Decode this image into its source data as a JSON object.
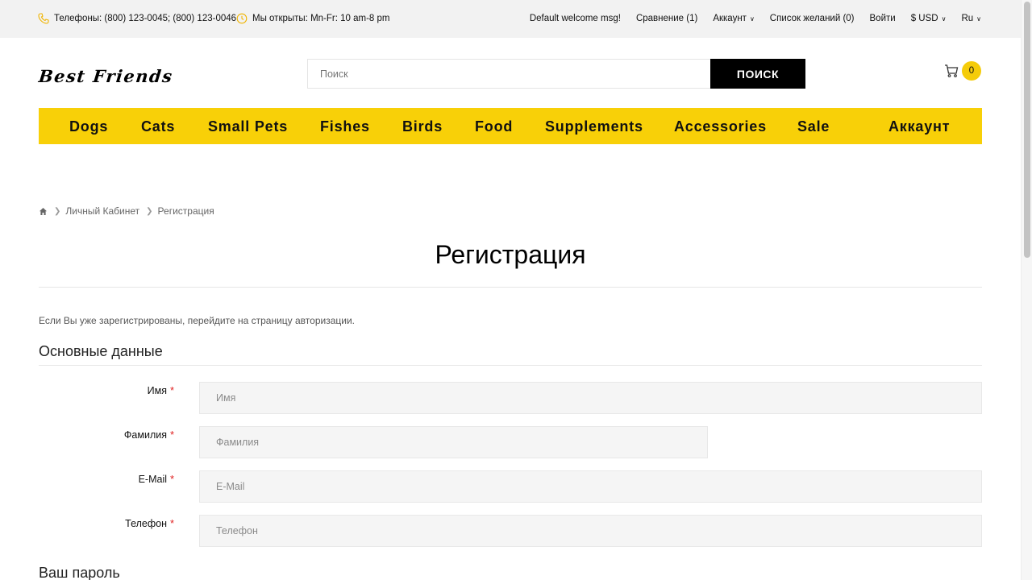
{
  "topbar": {
    "phones": "Телефоны: (800) 123-0045; (800) 123-0046",
    "hours": "Мы открыты: Mn-Fr: 10 am-8 pm",
    "welcome": "Default welcome msg!",
    "compare": "Сравнение (1)",
    "account": "Аккаунт",
    "wishlist": "Список желаний (0)",
    "login": "Войти",
    "currency": "$ USD",
    "language": "Ru"
  },
  "header": {
    "logo": "Best Friends",
    "search_placeholder": "Поиск",
    "search_button": "ПОИСК",
    "cart_count": "0"
  },
  "nav": {
    "items": [
      "Dogs",
      "Cats",
      "Small Pets",
      "Fishes",
      "Birds",
      "Food",
      "Supplements",
      "Accessories",
      "Sale",
      "Аккаунт"
    ]
  },
  "breadcrumb": {
    "items": [
      "Личный Кабинет",
      "Регистрация"
    ]
  },
  "page": {
    "title": "Регистрация",
    "intro": "Если Вы уже зарегистрированы, перейдите на страницу авторизации.",
    "section_main": "Основные данные",
    "section_password": "Ваш пароль",
    "required_mark": "*"
  },
  "form": {
    "first_name": {
      "label": "Имя",
      "placeholder": "Имя"
    },
    "last_name": {
      "label": "Фамилия",
      "placeholder": "Фамилия"
    },
    "email": {
      "label": "E-Mail",
      "placeholder": "E-Mail"
    },
    "phone": {
      "label": "Телефон",
      "placeholder": "Телефон"
    }
  },
  "colors": {
    "accent": "#f8d008",
    "button": "#000000",
    "required": "#e02020"
  }
}
